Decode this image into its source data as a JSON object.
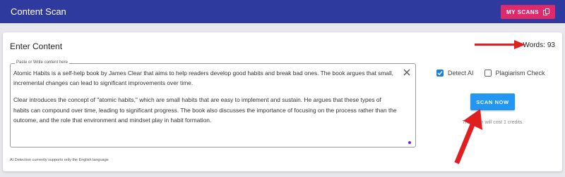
{
  "app": {
    "title": "Content Scan",
    "my_scans_label": "MY SCANS"
  },
  "editor": {
    "heading": "Enter Content",
    "words_label": "Words:",
    "words_count": "93",
    "field_label": "Paste or Write content here",
    "paragraph_1": "Atomic Habits is a self-help book by James Clear that aims to help readers develop good habits and break bad ones. The book argues that small, incremental changes can lead to significant improvements over time.",
    "paragraph_2": "Clear introduces the concept of \"atomic habits,\" which are small habits that are easy to implement and sustain. He argues that these types of habits can compound over time, leading to significant progress. The book also discusses the importance of focusing on the process rather than the outcome, and the role that environment and mindset play in habit formation.",
    "support_note": "AI Detection currently supports only the English language"
  },
  "options": {
    "detect_ai_label": "Detect AI",
    "detect_ai_checked": true,
    "plagiarism_label": "Plagiarism Check",
    "plagiarism_checked": false
  },
  "scan": {
    "button_label": "SCAN NOW",
    "cost_note": "This scan will cost 1 credits."
  },
  "colors": {
    "appbar": "#2f3a9e",
    "my_scans_button": "#e0296b",
    "scan_button": "#2196f3",
    "checkbox": "#1e7fd6",
    "annotation_arrow": "#e02020"
  },
  "icons": {
    "copy": "copy-icon",
    "clear": "close-icon",
    "check": "check-icon"
  }
}
